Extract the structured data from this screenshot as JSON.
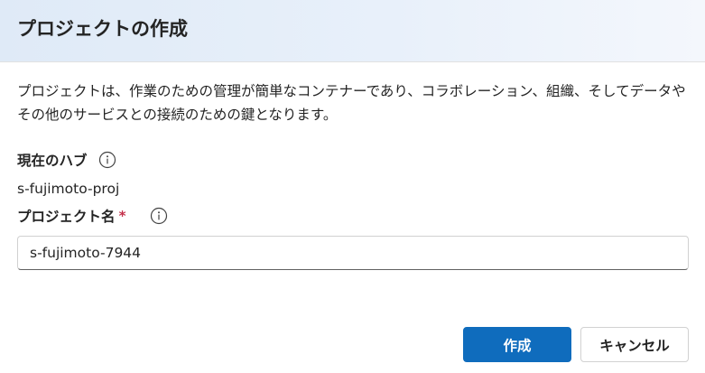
{
  "dialog": {
    "title": "プロジェクトの作成",
    "description": "プロジェクトは、作業のための管理が簡単なコンテナーであり、コラボレーション、組織、そしてデータやその他のサービスとの接続のための鍵となります。"
  },
  "hub": {
    "label": "現在のハブ",
    "info_icon": "info-icon",
    "value": "s-fujimoto-proj"
  },
  "project_name": {
    "label": "プロジェクト名",
    "required_marker": "*",
    "info_icon": "info-icon",
    "value": "s-fujimoto-7944"
  },
  "actions": {
    "create_label": "作成",
    "cancel_label": "キャンセル"
  },
  "colors": {
    "primary": "#0f6cbd",
    "required": "#c4314b",
    "text": "#242424"
  }
}
